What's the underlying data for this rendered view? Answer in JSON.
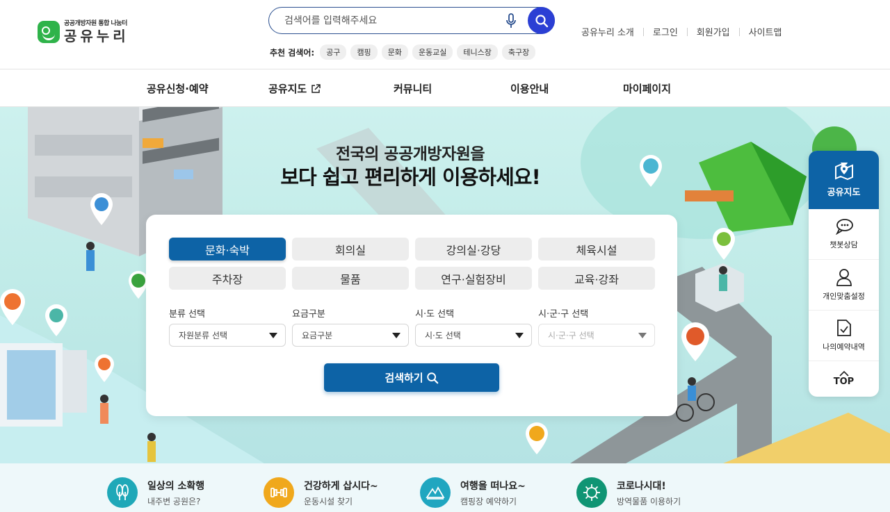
{
  "logo": {
    "sub": "공공개방자원 통합 나눔터",
    "main": "공유누리"
  },
  "search": {
    "placeholder": "검색어를 입력해주세요"
  },
  "recommend": {
    "label": "추천 검색어:",
    "tags": [
      "공구",
      "캠핑",
      "문화",
      "운동교실",
      "테니스장",
      "축구장"
    ]
  },
  "util_nav": [
    "공유누리 소개",
    "로그인",
    "회원가입",
    "사이트맵"
  ],
  "gnb": [
    "공유신청·예약",
    "공유지도",
    "커뮤니티",
    "이용안내",
    "마이페이지"
  ],
  "hero": {
    "title1": "전국의 공공개방자원을",
    "title2": "보다 쉽고 편리하게 이용하세요!"
  },
  "categories": [
    "문화·숙박",
    "회의실",
    "강의실·강당",
    "체육시설",
    "주차장",
    "물품",
    "연구·실험장비",
    "교육·강좌"
  ],
  "active_category": "문화·숙박",
  "filters": [
    {
      "label": "분류 선택",
      "value": "자원분류 선택"
    },
    {
      "label": "요금구분",
      "value": "요금구분"
    },
    {
      "label": "시·도 선택",
      "value": "시·도 선택"
    },
    {
      "label": "시·군·구 선택",
      "value": "시·군·구 선택"
    }
  ],
  "search_button": "검색하기",
  "quick_menu": {
    "top": "공유지도",
    "items": [
      "챗봇상담",
      "개인맞춤설정",
      "나의예약내역"
    ],
    "top_btn": "TOP"
  },
  "bottom_links": [
    {
      "title": "일상의 소확행",
      "sub": "내주변 공원은?",
      "color": "#1fa8b8"
    },
    {
      "title": "건강하게 삽시다~",
      "sub": "운동시설 찾기",
      "color": "#f0a81c"
    },
    {
      "title": "여행을 떠나요~",
      "sub": "캠핑장 예약하기",
      "color": "#20a6c0"
    },
    {
      "title": "코로나시대!",
      "sub": "방역물품 이용하기",
      "color": "#109574"
    }
  ]
}
